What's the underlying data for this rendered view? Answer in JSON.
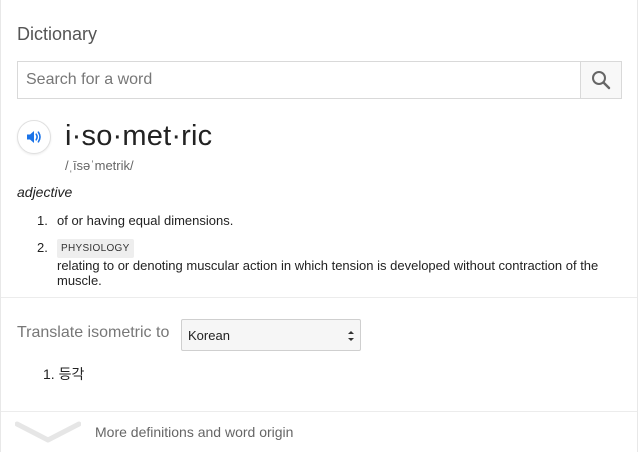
{
  "header": {
    "title": "Dictionary"
  },
  "search": {
    "placeholder": "Search for a word",
    "value": ""
  },
  "entry": {
    "word": "i·so·met·ric",
    "phonetic": "/ˌīsəˈmetrik/",
    "part_of_speech": "adjective",
    "definitions": [
      {
        "number": "1.",
        "text": "of or having equal dimensions.",
        "tag": ""
      },
      {
        "number": "2.",
        "text": "relating to or denoting muscular action in which tension is developed without contraction of the muscle.",
        "tag": "PHYSIOLOGY"
      }
    ]
  },
  "translate": {
    "label": "Translate isometric to",
    "selected_language": "Korean",
    "result_number": "1.",
    "result_text": "등각"
  },
  "footer": {
    "more_label": "More definitions and word origin"
  },
  "colors": {
    "speaker_blue": "#1a73e8",
    "divider": "#ececec"
  }
}
